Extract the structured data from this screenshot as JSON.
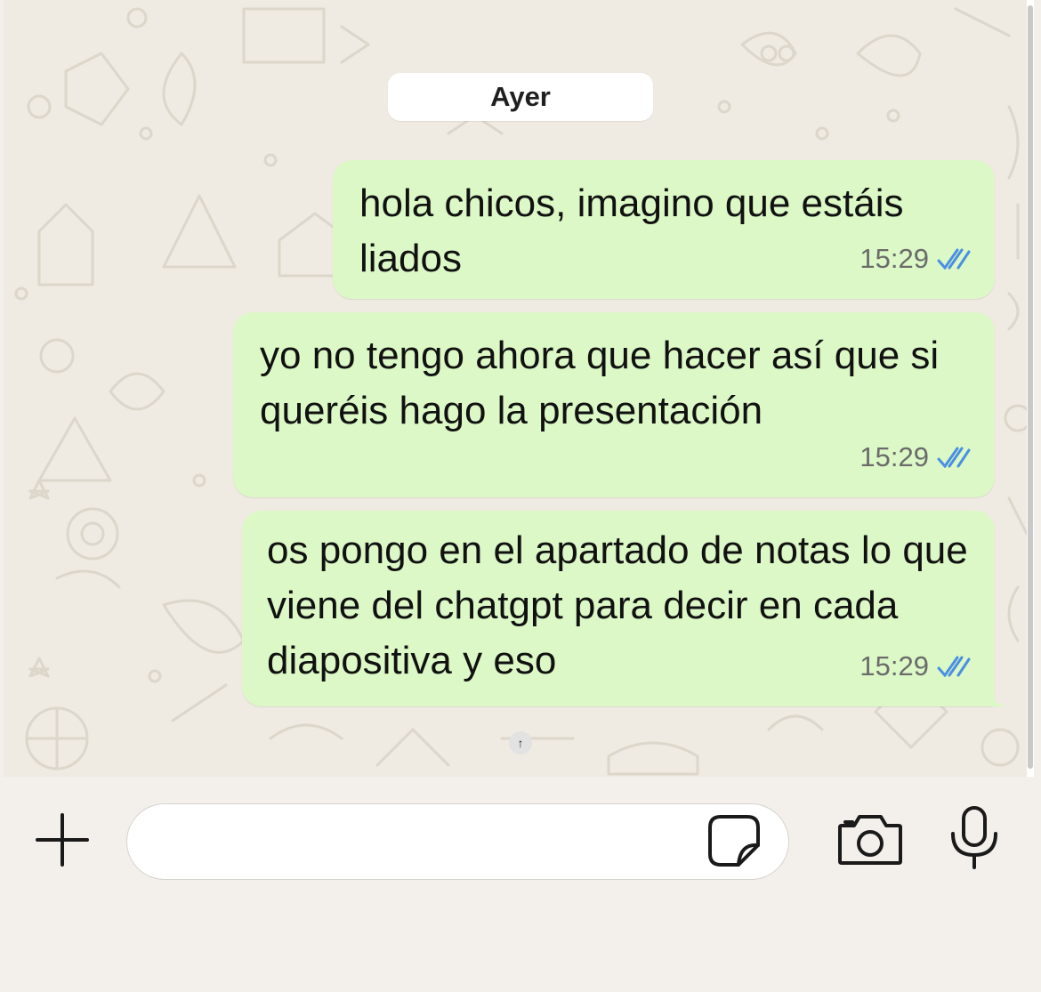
{
  "date_separator": "Ayer",
  "messages": [
    {
      "text": "hola chicos, imagino que estáis liados",
      "time": "15:29",
      "status": "read"
    },
    {
      "text": "yo no tengo ahora que hacer así que si queréis hago la presentación",
      "time": "15:29",
      "status": "read"
    },
    {
      "text": "os pongo en el apartado de notas lo que viene del chatgpt para decir en cada diapositiva y eso",
      "time": "15:29",
      "status": "read"
    }
  ],
  "jump_button_symbol": "↑",
  "composer": {
    "input_value": "",
    "icons": [
      "plus-icon",
      "sticker-icon",
      "camera-icon",
      "microphone-icon"
    ]
  },
  "colors": {
    "outgoing_bubble": "#dcf8c6",
    "read_ticks": "#4a90e2",
    "chat_background": "#efeae2"
  }
}
